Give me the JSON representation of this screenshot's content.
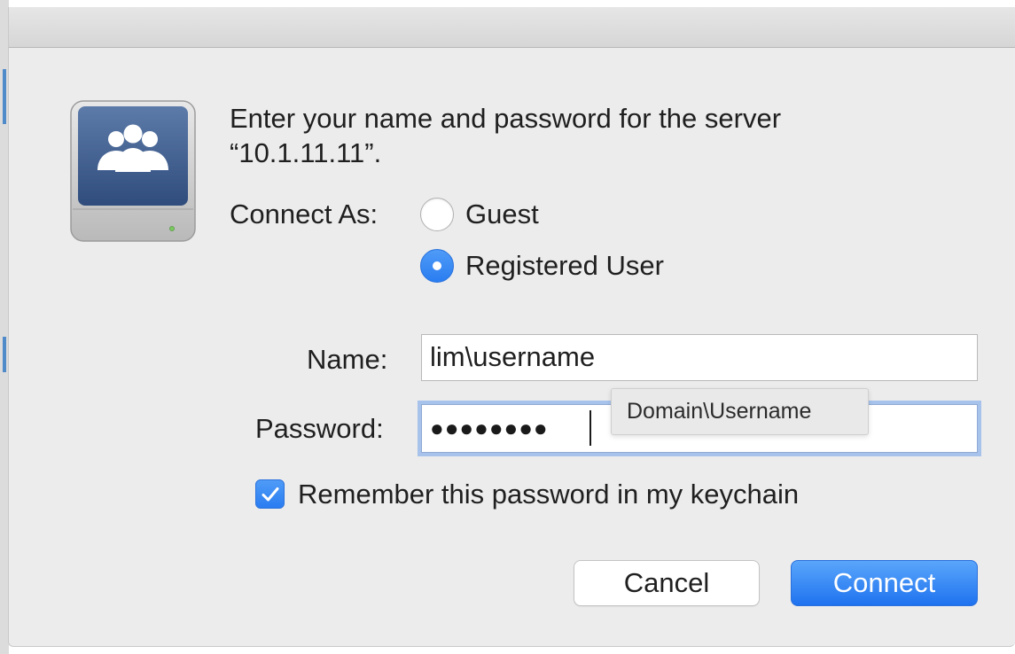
{
  "dialog": {
    "message_line1": "Enter your name and password for the server",
    "message_line2": "“10.1.11.11”."
  },
  "icons": {
    "server": "server-drive-icon",
    "group": "group-users-icon",
    "check": "checkmark-icon"
  },
  "connect_as": {
    "label": "Connect As:",
    "options": [
      {
        "label": "Guest",
        "selected": false
      },
      {
        "label": "Registered User",
        "selected": true
      }
    ]
  },
  "fields": {
    "name": {
      "label": "Name:",
      "value": "lim\\username"
    },
    "password": {
      "label": "Password:",
      "masked_value": "●●●●●●●●"
    }
  },
  "tooltip": {
    "text": "Domain\\Username"
  },
  "remember": {
    "label": "Remember this password in my keychain",
    "checked": true
  },
  "buttons": {
    "cancel": "Cancel",
    "connect": "Connect"
  },
  "colors": {
    "accent": "#2a7df1",
    "dialog_background": "#ececec",
    "focus_ring": "#a7c3ec"
  }
}
